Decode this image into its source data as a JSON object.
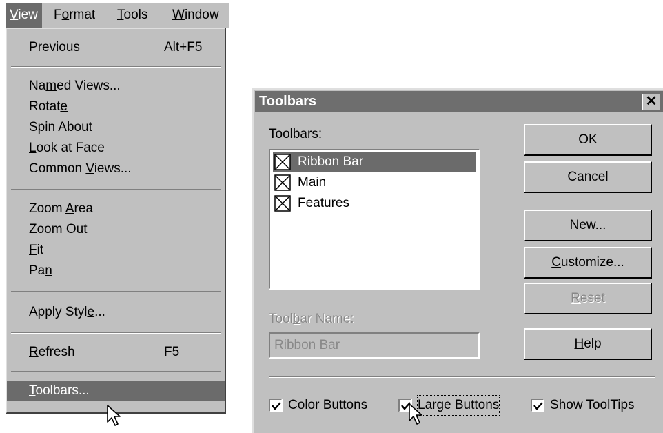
{
  "menubar": {
    "items": [
      {
        "label_pre": "",
        "label_u": "V",
        "label_post": "iew",
        "active": true
      },
      {
        "label_pre": "F",
        "label_u": "o",
        "label_post": "rmat",
        "active": false
      },
      {
        "label_pre": "",
        "label_u": "T",
        "label_post": "ools",
        "active": false
      },
      {
        "label_pre": "",
        "label_u": "W",
        "label_post": "indow",
        "active": false
      }
    ]
  },
  "view_menu": {
    "previous": {
      "pre": "",
      "u": "P",
      "post": "revious",
      "shortcut": "Alt+F5"
    },
    "named_views": {
      "pre": "Na",
      "u": "m",
      "post": "ed Views..."
    },
    "rotate": {
      "pre": "Rotat",
      "u": "e",
      "post": ""
    },
    "spin_about": {
      "pre": "Spin A",
      "u": "b",
      "post": "out"
    },
    "look_at_face": {
      "pre": "",
      "u": "L",
      "post": "ook at Face"
    },
    "common_views": {
      "pre": "Common ",
      "u": "V",
      "post": "iews..."
    },
    "zoom_area": {
      "pre": "Zoom ",
      "u": "A",
      "post": "rea"
    },
    "zoom_out": {
      "pre": "Zoom ",
      "u": "O",
      "post": "ut"
    },
    "fit": {
      "pre": "",
      "u": "F",
      "post": "it"
    },
    "pan": {
      "pre": "Pa",
      "u": "n",
      "post": ""
    },
    "apply_style": {
      "pre": "Apply Styl",
      "u": "e",
      "post": "..."
    },
    "refresh": {
      "pre": "",
      "u": "R",
      "post": "efresh",
      "shortcut": "F5"
    },
    "toolbars": {
      "pre": "",
      "u": "T",
      "post": "oolbars..."
    }
  },
  "dialog": {
    "title": "Toolbars",
    "close": "✕",
    "toolbars_label": {
      "pre": "",
      "u": "T",
      "post": "oolbars:"
    },
    "toolbar_list": [
      {
        "name": "Ribbon Bar",
        "selected": true
      },
      {
        "name": "Main",
        "selected": false
      },
      {
        "name": "Features",
        "selected": false
      }
    ],
    "toolbar_name_label": {
      "pre": "Tool",
      "u": "b",
      "post": "ar Name:"
    },
    "toolbar_name_value": "Ribbon Bar",
    "buttons": {
      "ok": "OK",
      "cancel": "Cancel",
      "new": {
        "pre": "",
        "u": "N",
        "post": "ew..."
      },
      "customize": {
        "pre": "",
        "u": "C",
        "post": "ustomize..."
      },
      "reset": {
        "pre": "",
        "u": "R",
        "post": "eset"
      },
      "help": {
        "pre": "",
        "u": "H",
        "post": "elp"
      }
    },
    "options": {
      "color_buttons": {
        "pre": "C",
        "u": "o",
        "post": "lor Buttons",
        "checked": true
      },
      "large_buttons": {
        "pre": "",
        "u": "L",
        "post": "arge Buttons",
        "checked": true
      },
      "show_tooltips": {
        "pre": "",
        "u": "S",
        "post": "how ToolTips",
        "checked": true
      }
    }
  },
  "colors": {
    "highlight": "#6b6b6b",
    "face": "#c0c0c0"
  }
}
